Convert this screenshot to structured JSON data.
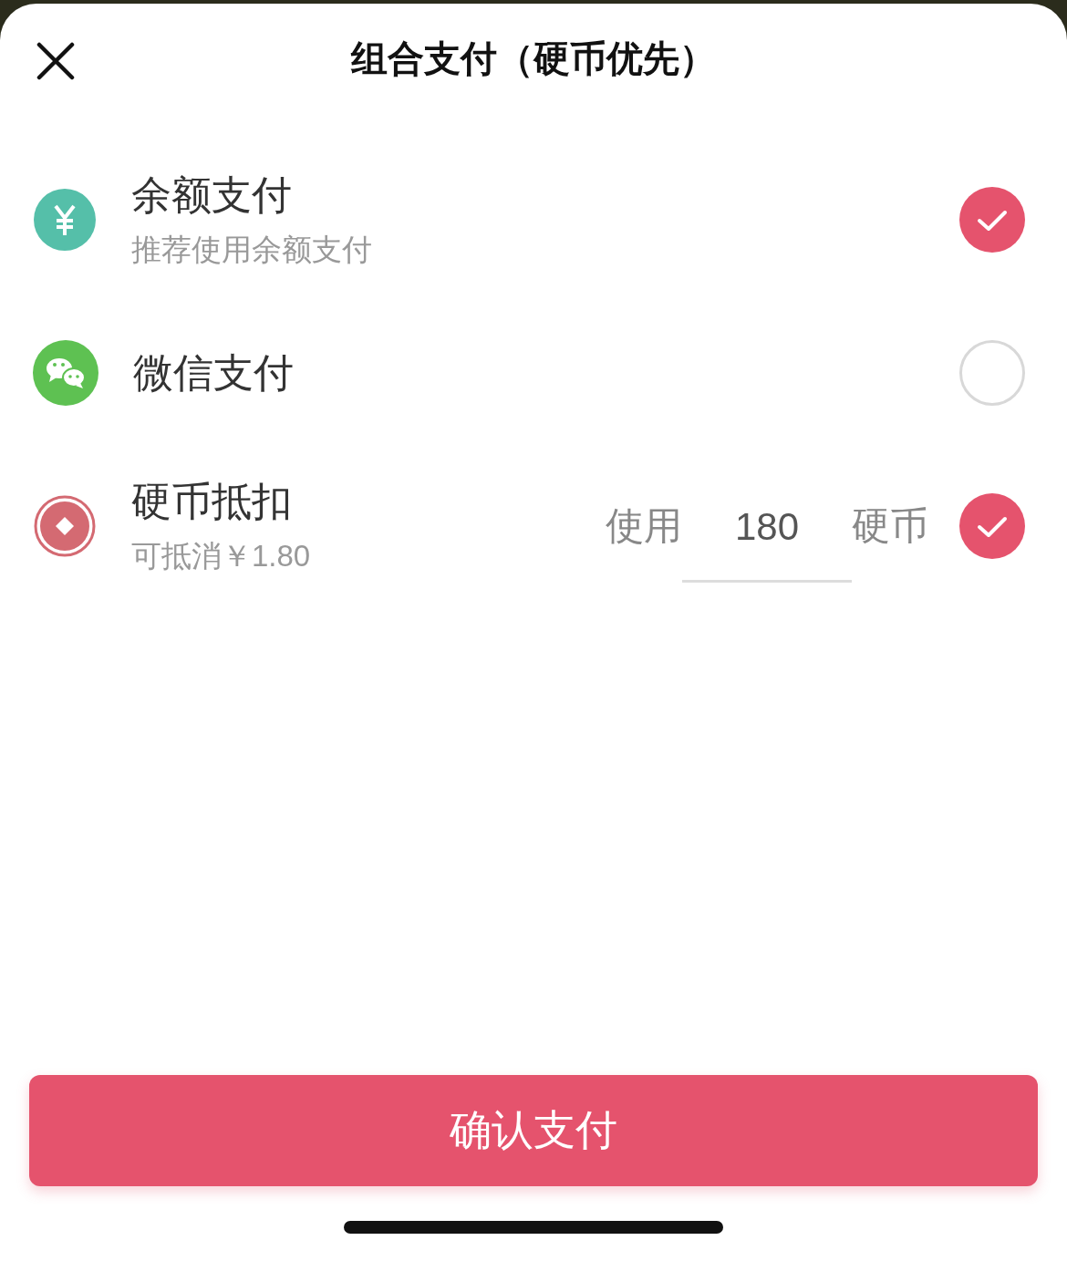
{
  "header": {
    "title": "组合支付（硬币优先）"
  },
  "methods": [
    {
      "kind": "balance",
      "title": "余额支付",
      "subtitle": "推荐使用余额支付",
      "checked": true
    },
    {
      "kind": "wechat",
      "title": "微信支付",
      "checked": false
    },
    {
      "kind": "coin",
      "title": "硬币抵扣",
      "subtitle": "可抵消￥1.80",
      "checked": true,
      "amount": {
        "prefix": "使用",
        "value": "180",
        "suffix": "硬币"
      }
    }
  ],
  "confirm_button": "确认支付"
}
